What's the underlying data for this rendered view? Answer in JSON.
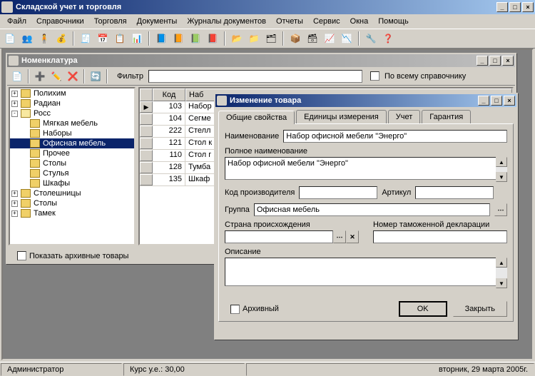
{
  "app": {
    "title": "Складской учет и торговля"
  },
  "menu": [
    "Файл",
    "Справочники",
    "Торговля",
    "Документы",
    "Журналы документов",
    "Отчеты",
    "Сервис",
    "Окна",
    "Помощь"
  ],
  "nomenclature": {
    "title": "Номенклатура",
    "filter_label": "Фильтр",
    "filter_value": "",
    "all_ref_label": "По всему справочнику",
    "show_archive_label": "Показать архивные товары",
    "tree": [
      {
        "level": 0,
        "toggle": "+",
        "label": "Полихим"
      },
      {
        "level": 0,
        "toggle": "+",
        "label": "Радиан"
      },
      {
        "level": 0,
        "toggle": "-",
        "label": "Росс",
        "open": true
      },
      {
        "level": 1,
        "toggle": "",
        "label": "Мягкая мебель"
      },
      {
        "level": 1,
        "toggle": "",
        "label": "Наборы"
      },
      {
        "level": 1,
        "toggle": "",
        "label": "Офисная мебель",
        "selected": true
      },
      {
        "level": 1,
        "toggle": "",
        "label": "Прочее"
      },
      {
        "level": 1,
        "toggle": "",
        "label": "Столы"
      },
      {
        "level": 1,
        "toggle": "",
        "label": "Стулья"
      },
      {
        "level": 1,
        "toggle": "",
        "label": "Шкафы"
      },
      {
        "level": 0,
        "toggle": "+",
        "label": "Столешницы"
      },
      {
        "level": 0,
        "toggle": "+",
        "label": "Столы"
      },
      {
        "level": 0,
        "toggle": "+",
        "label": "Тамек"
      }
    ],
    "grid": {
      "headers": {
        "code": "Код",
        "name": "Наб"
      },
      "rows": [
        {
          "code": "103",
          "name": "Набор"
        },
        {
          "code": "104",
          "name": "Сегме"
        },
        {
          "code": "222",
          "name": "Стелл"
        },
        {
          "code": "121",
          "name": "Стол к"
        },
        {
          "code": "110",
          "name": "Стол г"
        },
        {
          "code": "128",
          "name": "Тумба"
        },
        {
          "code": "135",
          "name": "Шкаф"
        }
      ]
    }
  },
  "edit": {
    "title": "Изменение товара",
    "tabs": [
      "Общие свойства",
      "Единицы измерения",
      "Учет",
      "Гарантия"
    ],
    "name_label": "Наименование",
    "name_value": "Набор офисной мебели \"Энерго\"",
    "fullname_label": "Полное наименование",
    "fullname_value": "Набор офисной мебели \"Энерго\"",
    "mfrcode_label": "Код производителя",
    "mfrcode_value": "",
    "article_label": "Артикул",
    "article_value": "",
    "group_label": "Группа",
    "group_value": "Офисная мебель",
    "country_label": "Страна происхождения",
    "country_value": "",
    "customs_label": "Номер таможенной декларации",
    "customs_value": "",
    "desc_label": "Описание",
    "desc_value": "",
    "archive_label": "Архивный",
    "ok_label": "OK",
    "close_label": "Закрыть"
  },
  "status": {
    "user": "Администратор",
    "rate": "Курс у.е.: 30,00",
    "date": "вторник, 29 марта 2005г."
  }
}
